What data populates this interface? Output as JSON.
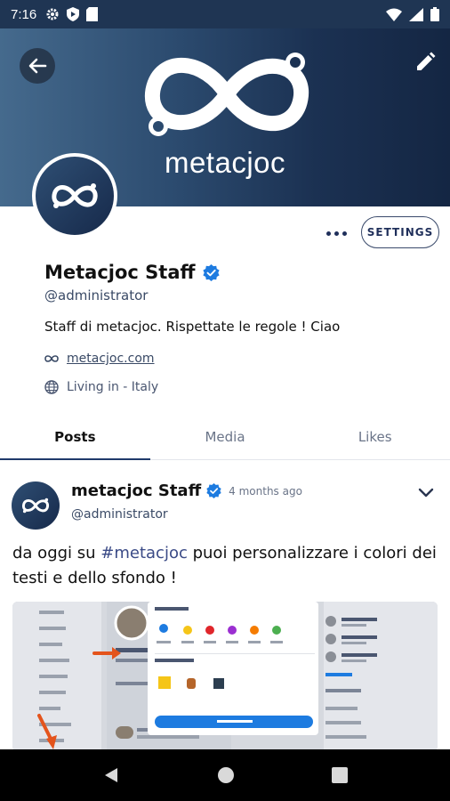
{
  "status_bar": {
    "time": "7:16"
  },
  "cover": {
    "brand": "metacjoc"
  },
  "actions": {
    "settings_label": "SETTINGS"
  },
  "profile": {
    "name": "Metacjoc Staff",
    "handle": "@administrator",
    "bio": "Staff di metacjoc. Rispettate le regole ! Ciao",
    "website": "metacjoc.com",
    "location": "Living in - Italy"
  },
  "tabs": [
    {
      "label": "Posts"
    },
    {
      "label": "Media"
    },
    {
      "label": "Likes"
    }
  ],
  "post": {
    "author": "metacjoc Staff",
    "time": "4 months ago",
    "handle": "@administrator",
    "text_before": "da oggi su ",
    "hashtag": "#metacjoc",
    "text_after": " puoi personalizzare i colori dei testi e dello sfondo !"
  },
  "colors": {
    "accent": "#1f3a6b",
    "cover_dark": "#142643",
    "verified": "#1d7be0"
  }
}
